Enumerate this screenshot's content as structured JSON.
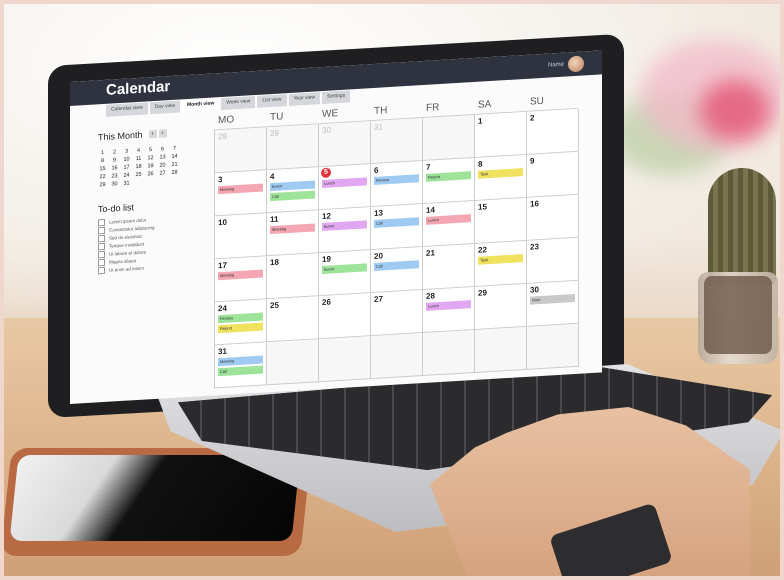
{
  "colors": {
    "topbar": "#2f3340",
    "pink": "#f4a7b3",
    "green": "#9ee39a",
    "blue": "#9fcbf3",
    "yellow": "#f0e15f",
    "purple": "#e1a7f0",
    "gray": "#c9c9c9",
    "today": "#e0333a"
  },
  "app": {
    "title": "Calendar",
    "user_name": "Name"
  },
  "tabs": [
    {
      "label": "Calendar view",
      "active": false
    },
    {
      "label": "Day view",
      "active": false
    },
    {
      "label": "Month view",
      "active": true
    },
    {
      "label": "Week view",
      "active": false
    },
    {
      "label": "List view",
      "active": false
    },
    {
      "label": "Year view",
      "active": false
    },
    {
      "label": "Settings",
      "active": false
    }
  ],
  "sidebar": {
    "month_title": "This Month",
    "prev_icon": "chevron-left-icon",
    "next_icon": "chevron-right-icon",
    "mini_days": [
      "1",
      "2",
      "3",
      "4",
      "5",
      "6",
      "7",
      "8",
      "9",
      "10",
      "11",
      "12",
      "13",
      "14",
      "15",
      "16",
      "17",
      "18",
      "19",
      "20",
      "21",
      "22",
      "23",
      "24",
      "25",
      "26",
      "27",
      "28",
      "29",
      "30",
      "31"
    ],
    "todo_title": "To-do list",
    "todo_items": [
      "Lorem ipsum dolor",
      "Consectetur adipiscing",
      "Sed do eiusmod",
      "Tempor incididunt",
      "Ut labore et dolore",
      "Magna aliqua",
      "Ut enim ad minim"
    ]
  },
  "weekdays": [
    "MO",
    "TU",
    "WE",
    "TH",
    "FR",
    "SA",
    "SU"
  ],
  "weeks": [
    [
      {
        "d": "28",
        "out": true,
        "events": []
      },
      {
        "d": "29",
        "out": true,
        "events": []
      },
      {
        "d": "30",
        "out": true,
        "events": []
      },
      {
        "d": "31",
        "out": true,
        "events": []
      },
      {
        "d": "",
        "out": true,
        "events": []
      },
      {
        "d": "1",
        "events": []
      },
      {
        "d": "2",
        "events": []
      }
    ],
    [
      {
        "d": "3",
        "events": [
          {
            "c": "pink",
            "t": "Meeting"
          }
        ]
      },
      {
        "d": "4",
        "events": [
          {
            "c": "blue",
            "t": "Event"
          },
          {
            "c": "green",
            "t": "Call"
          }
        ]
      },
      {
        "d": "5",
        "today": true,
        "events": [
          {
            "c": "purple",
            "t": "Lunch"
          }
        ]
      },
      {
        "d": "6",
        "events": [
          {
            "c": "blue",
            "t": "Review"
          }
        ]
      },
      {
        "d": "7",
        "events": [
          {
            "c": "green",
            "t": "Report"
          }
        ]
      },
      {
        "d": "8",
        "events": [
          {
            "c": "yellow",
            "t": "Task"
          }
        ]
      },
      {
        "d": "9",
        "events": []
      }
    ],
    [
      {
        "d": "10",
        "events": []
      },
      {
        "d": "11",
        "events": [
          {
            "c": "pink",
            "t": "Meeting"
          }
        ]
      },
      {
        "d": "12",
        "events": [
          {
            "c": "purple",
            "t": "Event"
          }
        ]
      },
      {
        "d": "13",
        "events": [
          {
            "c": "blue",
            "t": "Call"
          }
        ]
      },
      {
        "d": "14",
        "events": [
          {
            "c": "pink",
            "t": "Lunch"
          }
        ]
      },
      {
        "d": "15",
        "events": []
      },
      {
        "d": "16",
        "events": []
      }
    ],
    [
      {
        "d": "17",
        "events": [
          {
            "c": "pink",
            "t": "Meeting"
          }
        ]
      },
      {
        "d": "18",
        "events": []
      },
      {
        "d": "19",
        "events": [
          {
            "c": "green",
            "t": "Event"
          }
        ]
      },
      {
        "d": "20",
        "events": [
          {
            "c": "blue",
            "t": "Call"
          }
        ]
      },
      {
        "d": "21",
        "events": []
      },
      {
        "d": "22",
        "events": [
          {
            "c": "yellow",
            "t": "Task"
          }
        ]
      },
      {
        "d": "23",
        "events": []
      }
    ],
    [
      {
        "d": "24",
        "events": [
          {
            "c": "green",
            "t": "Review"
          },
          {
            "c": "yellow",
            "t": "Report"
          }
        ]
      },
      {
        "d": "25",
        "events": []
      },
      {
        "d": "26",
        "events": []
      },
      {
        "d": "27",
        "events": []
      },
      {
        "d": "28",
        "events": [
          {
            "c": "purple",
            "t": "Lunch"
          }
        ]
      },
      {
        "d": "29",
        "events": []
      },
      {
        "d": "30",
        "events": [
          {
            "c": "gray",
            "t": "Note"
          }
        ]
      }
    ],
    [
      {
        "d": "31",
        "events": [
          {
            "c": "blue",
            "t": "Meeting"
          },
          {
            "c": "green",
            "t": "Call"
          }
        ]
      },
      {
        "d": "",
        "out": true,
        "events": []
      },
      {
        "d": "",
        "out": true,
        "events": []
      },
      {
        "d": "",
        "out": true,
        "events": []
      },
      {
        "d": "",
        "out": true,
        "events": []
      },
      {
        "d": "",
        "out": true,
        "events": []
      },
      {
        "d": "",
        "out": true,
        "events": []
      }
    ]
  ]
}
